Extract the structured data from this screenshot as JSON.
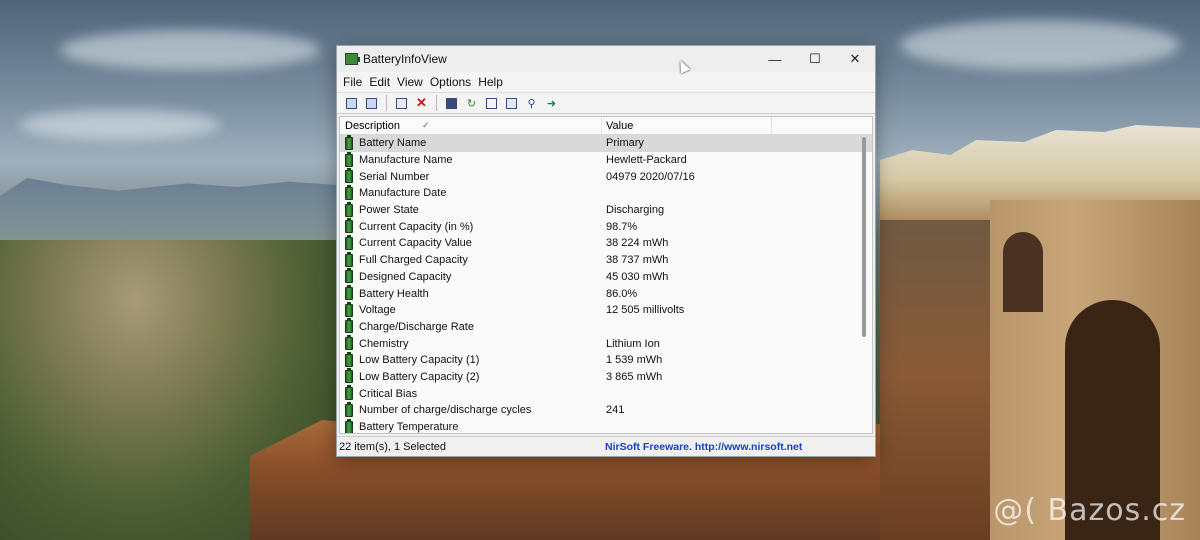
{
  "window": {
    "title": "BatteryInfoView",
    "controls": {
      "minimize": "—",
      "maximize": "☐",
      "close": "✕"
    }
  },
  "menu": [
    "File",
    "Edit",
    "View",
    "Options",
    "Help"
  ],
  "toolbar_icons": [
    "view-summary-icon",
    "view-list-icon",
    "properties-icon",
    "delete-icon",
    "save-icon",
    "refresh-icon",
    "copy-icon",
    "html-report-icon",
    "find-icon",
    "exit-icon"
  ],
  "columns": {
    "description": "Description",
    "value": "Value"
  },
  "rows": [
    {
      "label": "Battery Name",
      "value": "Primary"
    },
    {
      "label": "Manufacture Name",
      "value": "Hewlett-Packard"
    },
    {
      "label": "Serial Number",
      "value": "04979 2020/07/16"
    },
    {
      "label": "Manufacture Date",
      "value": ""
    },
    {
      "label": "Power State",
      "value": "Discharging"
    },
    {
      "label": "Current Capacity (in %)",
      "value": "98.7%"
    },
    {
      "label": "Current Capacity Value",
      "value": "38 224 mWh"
    },
    {
      "label": "Full Charged Capacity",
      "value": "38 737 mWh"
    },
    {
      "label": "Designed Capacity",
      "value": "45 030 mWh"
    },
    {
      "label": "Battery Health",
      "value": "86.0%"
    },
    {
      "label": "Voltage",
      "value": "12 505 millivolts"
    },
    {
      "label": "Charge/Discharge Rate",
      "value": ""
    },
    {
      "label": "Chemistry",
      "value": "Lithium Ion"
    },
    {
      "label": "Low Battery Capacity (1)",
      "value": "1 539 mWh"
    },
    {
      "label": "Low Battery Capacity (2)",
      "value": "3 865 mWh"
    },
    {
      "label": "Critical Bias",
      "value": ""
    },
    {
      "label": "Number of charge/discharge cycles",
      "value": "241"
    },
    {
      "label": "Battery Temperature",
      "value": ""
    }
  ],
  "selected_row": 0,
  "status": {
    "items": "22 item(s), 1 Selected",
    "link": "NirSoft Freeware.  http://www.nirsoft.net"
  },
  "watermark": "@( Bazos.cz",
  "colors": {
    "link": "#1a3fbf",
    "battery_icon": "#3a8a3a",
    "delete_icon": "#c81818"
  }
}
